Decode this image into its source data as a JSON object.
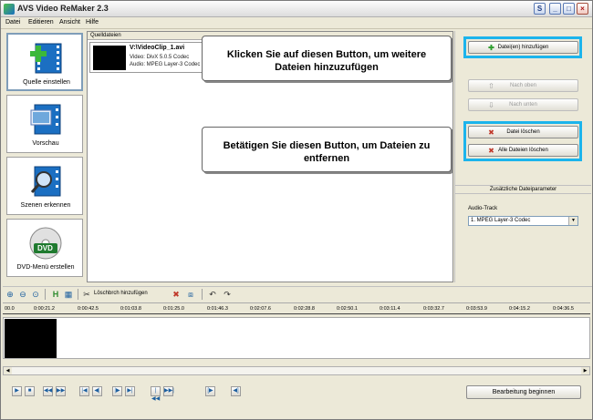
{
  "window": {
    "title": "AVS Video ReMaker 2.3",
    "help_glyph": "S",
    "min_glyph": "_",
    "max_glyph": "□",
    "close_glyph": "×"
  },
  "menu": [
    "Datei",
    "Editieren",
    "Ansicht",
    "Hilfe"
  ],
  "sidebar": [
    {
      "label": "Quelle einstellen",
      "icon": "add-source-icon"
    },
    {
      "label": "Vorschau",
      "icon": "preview-icon"
    },
    {
      "label": "Szenen erkennen",
      "icon": "scene-detect-icon"
    },
    {
      "label": "DVD-Menü erstellen",
      "icon": "dvd-menu-icon",
      "icon_text": "DVD"
    }
  ],
  "file_panel": {
    "header": "Quelldateien",
    "file": {
      "name": "V:\\VideoClip_1.avi",
      "video": "Video: DivX 5.0.5 Codec",
      "audio": "Audio: MPEG Layer-3 Codec"
    }
  },
  "right_panel": {
    "add_files": "Datei(en) hinzufügen",
    "move_up": "Nach oben",
    "move_down": "Nach unten",
    "delete_file": "Datei löschen",
    "delete_all": "Alle Dateien löschen",
    "extra_params": "Zusätzliche Dateiparameter",
    "audio_track_label": "Audio-Track",
    "audio_track_value": "1. MPEG Layer-3 Codec"
  },
  "callouts": {
    "add_hint": "Klicken Sie auf diesen Button, um weitere Dateien hinzuzufügen",
    "delete_hint": "Betätigen Sie diesen Button, um Dateien zu entfernen"
  },
  "toolbar": {
    "remove_break": "Löschbrch hinzufügen"
  },
  "ruler_ticks": [
    "00.0",
    "0:00:21.2",
    "0:00:42.5",
    "0:01:03.8",
    "0:01:25.0",
    "0:01:46.3",
    "0:02:07.6",
    "0:02:28.8",
    "0:02:50.1",
    "0:03:11.4",
    "0:03:32.7",
    "0:03:53.9",
    "0:04:15.2",
    "0:04:36.5"
  ],
  "transport": {
    "start_label": "Bearbeitung beginnen"
  },
  "colors": {
    "highlight": "#1cb4ec",
    "window_bg": "#ece9d8"
  }
}
